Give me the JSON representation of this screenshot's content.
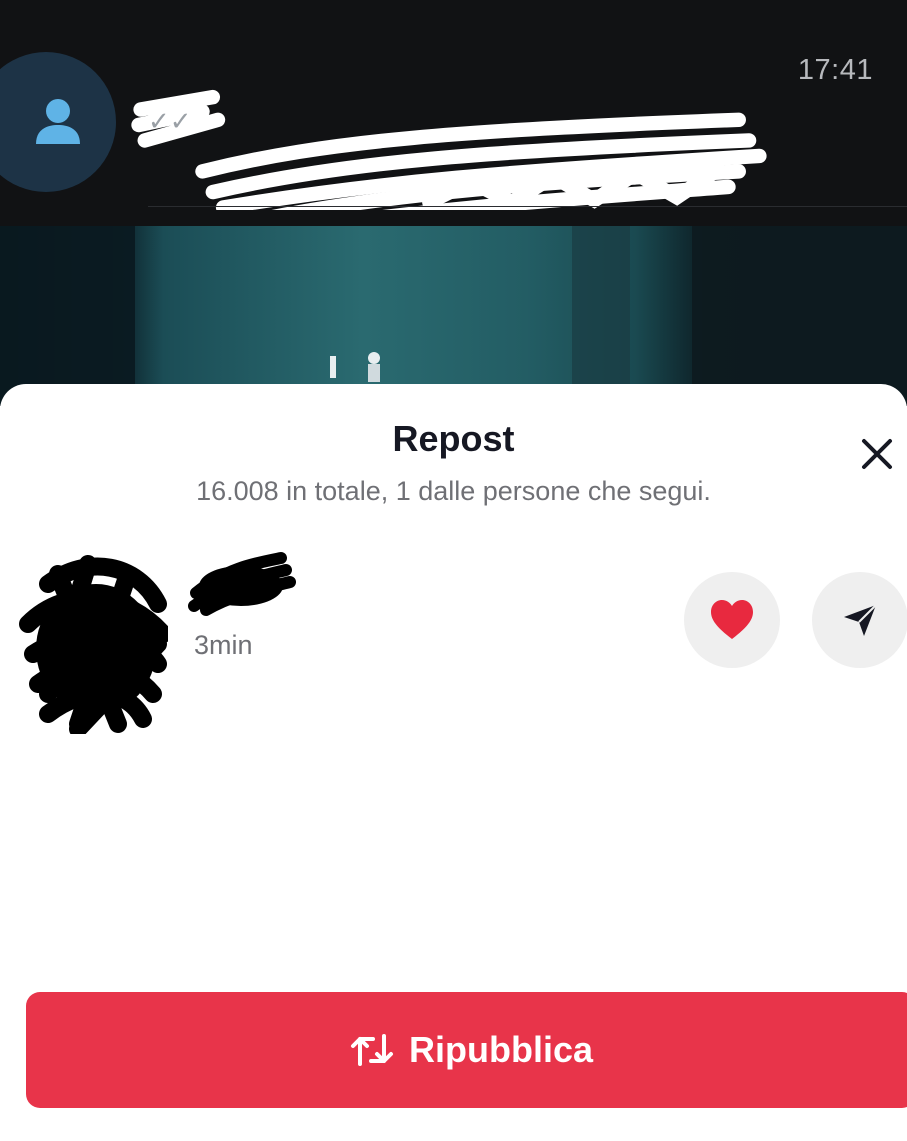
{
  "notification": {
    "time": "17:41",
    "status_ticks": "✓✓"
  },
  "sheet": {
    "title": "Repost",
    "subtitle": "16.008 in totale, 1 dalle persone che segui.",
    "close_icon": "close-icon"
  },
  "reposter": {
    "time_ago": "3min",
    "like_icon": "heart-icon",
    "send_icon": "send-icon"
  },
  "action": {
    "label": "Ripubblica",
    "icon": "repost-icon"
  },
  "colors": {
    "accent": "#e8344a",
    "heart": "#e8293f",
    "avatar_bg": "#1d3346",
    "avatar_icon": "#5fb3e6"
  }
}
